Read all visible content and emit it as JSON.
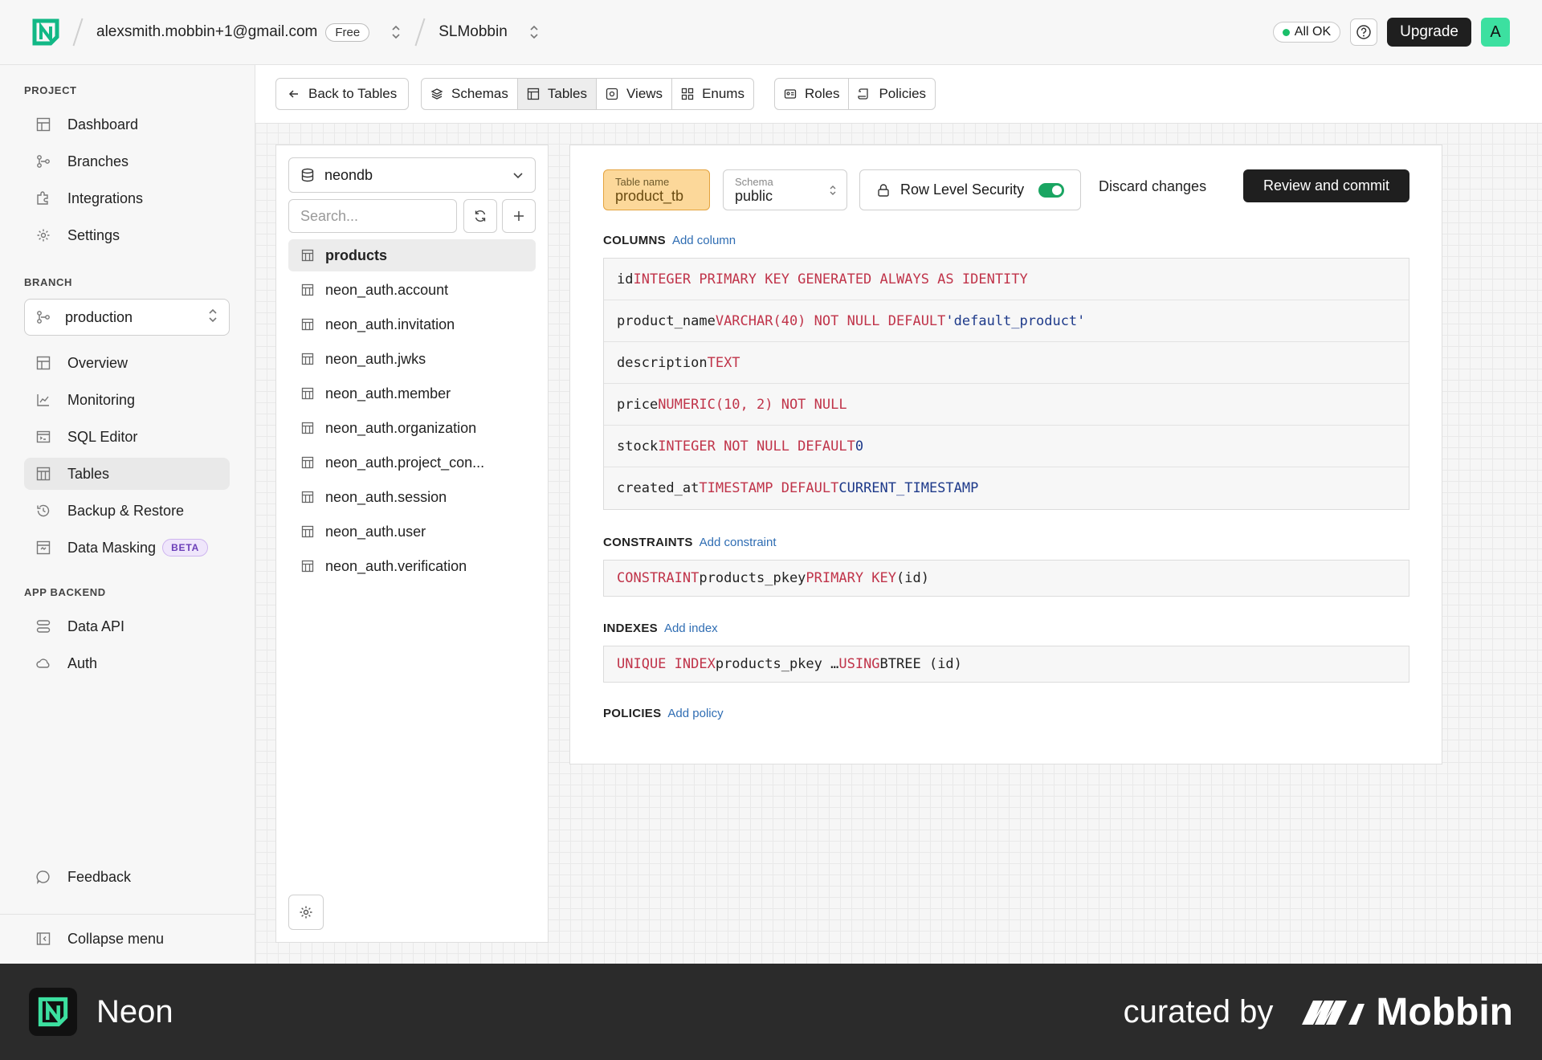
{
  "topbar": {
    "account_email": "alexsmith.mobbin+1@gmail.com",
    "plan_badge": "Free",
    "project_name": "SLMobbin",
    "status_text": "All OK",
    "upgrade_label": "Upgrade",
    "avatar_letter": "A"
  },
  "sidebar": {
    "project_section": "PROJECT",
    "project_items": [
      "Dashboard",
      "Branches",
      "Integrations",
      "Settings"
    ],
    "branch_section": "BRANCH",
    "branch_value": "production",
    "branch_items": [
      "Overview",
      "Monitoring",
      "SQL Editor",
      "Tables",
      "Backup & Restore",
      "Data Masking"
    ],
    "beta_badge": "BETA",
    "backend_section": "APP BACKEND",
    "backend_items": [
      "Data API",
      "Auth"
    ],
    "feedback_label": "Feedback",
    "collapse_label": "Collapse menu"
  },
  "toolbar": {
    "back_label": "Back to Tables",
    "schemas_label": "Schemas",
    "tables_label": "Tables",
    "views_label": "Views",
    "enums_label": "Enums",
    "roles_label": "Roles",
    "policies_label": "Policies"
  },
  "table_list": {
    "database": "neondb",
    "search_placeholder": "Search...",
    "tables": [
      "products",
      "neon_auth.account",
      "neon_auth.invitation",
      "neon_auth.jwks",
      "neon_auth.member",
      "neon_auth.organization",
      "neon_auth.project_con...",
      "neon_auth.session",
      "neon_auth.user",
      "neon_auth.verification"
    ]
  },
  "editor": {
    "table_name_label": "Table name",
    "table_name_value": "product_tb",
    "schema_label": "Schema",
    "schema_value": "public",
    "rls_label": "Row Level Security",
    "discard_label": "Discard changes",
    "commit_label": "Review and commit",
    "columns_head": "COLUMNS",
    "add_column": "Add column",
    "columns": [
      {
        "name": "id",
        "kw": "INTEGER PRIMARY KEY GENERATED ALWAYS AS IDENTITY",
        "lit": ""
      },
      {
        "name": "product_name",
        "kw": "VARCHAR(40) NOT NULL DEFAULT",
        "lit": "'default_product'"
      },
      {
        "name": "description",
        "kw": "TEXT",
        "lit": ""
      },
      {
        "name": "price",
        "kw": "NUMERIC(10, 2) NOT NULL",
        "lit": ""
      },
      {
        "name": "stock",
        "kw": "INTEGER NOT NULL DEFAULT",
        "lit": "0"
      },
      {
        "name": "created_at",
        "kw": "TIMESTAMP DEFAULT",
        "lit": "CURRENT_TIMESTAMP"
      }
    ],
    "constraints_head": "CONSTRAINTS",
    "add_constraint": "Add constraint",
    "constraint": {
      "kw1": "CONSTRAINT",
      "name": "products_pkey",
      "kw2": "PRIMARY KEY",
      "tail": "(id)"
    },
    "indexes_head": "INDEXES",
    "add_index": "Add index",
    "index": {
      "kw1": "UNIQUE INDEX",
      "name": "products_pkey …",
      "kw2": "USING",
      "tail": "BTREE (id)"
    },
    "policies_head": "POLICIES",
    "add_policy": "Add policy"
  },
  "footer": {
    "app_name": "Neon",
    "curated_by": "curated by",
    "brand": "Mobbin"
  }
}
